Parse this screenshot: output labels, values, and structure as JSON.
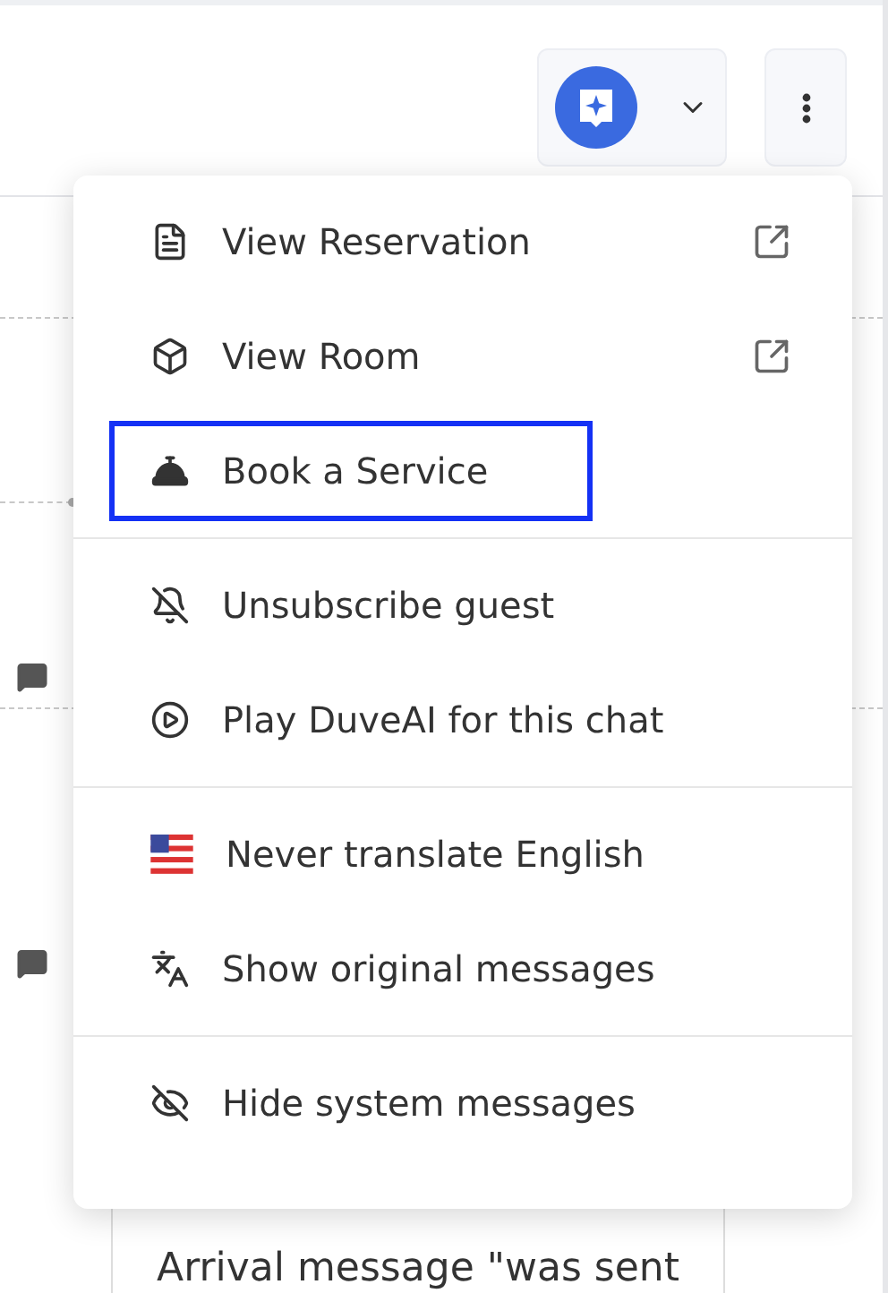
{
  "menu": {
    "groups": [
      {
        "items": [
          {
            "label": "View Reservation",
            "external": true,
            "highlighted": false
          },
          {
            "label": "View Room",
            "external": true,
            "highlighted": false
          },
          {
            "label": "Book a Service",
            "external": false,
            "highlighted": true
          }
        ]
      },
      {
        "items": [
          {
            "label": "Unsubscribe guest",
            "external": false,
            "highlighted": false
          },
          {
            "label": "Play DuveAI for this chat",
            "external": false,
            "highlighted": false
          }
        ]
      },
      {
        "items": [
          {
            "label": "Never translate English",
            "external": false,
            "highlighted": false
          },
          {
            "label": "Show original messages",
            "external": false,
            "highlighted": false
          }
        ]
      },
      {
        "items": [
          {
            "label": "Hide system messages",
            "external": false,
            "highlighted": false
          }
        ]
      }
    ]
  },
  "background": {
    "message": "Arrival message \"was sent"
  }
}
